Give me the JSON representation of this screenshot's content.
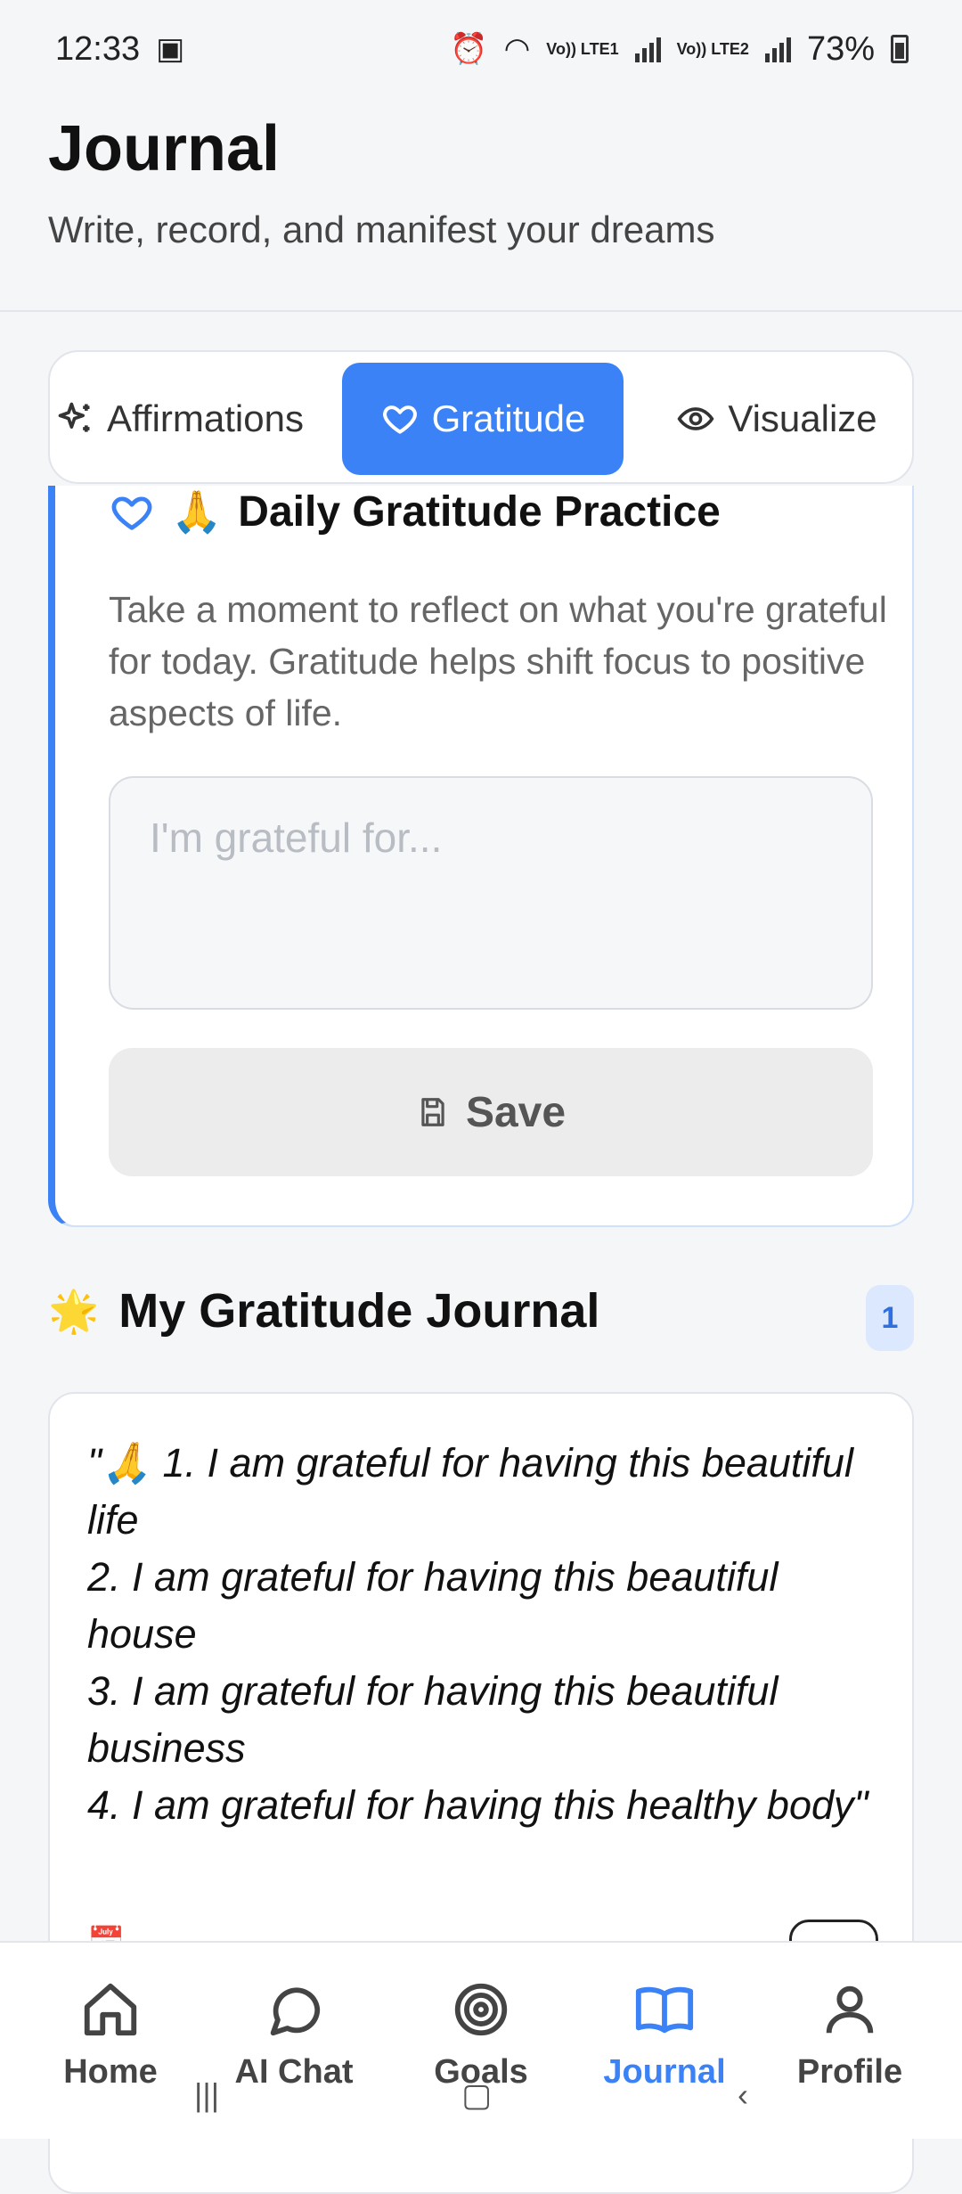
{
  "status_bar": {
    "time": "12:33",
    "battery": "73%",
    "sim1_label": "Vo)) LTE1",
    "sim2_label": "Vo)) LTE2",
    "icons": [
      "image-icon",
      "alarm-icon",
      "wifi-icon",
      "signal-icon",
      "battery-icon"
    ]
  },
  "header": {
    "title": "Journal",
    "subtitle": "Write, record, and manifest your dreams"
  },
  "tabs": [
    {
      "label": "Affirmations",
      "icon": "sparkles-icon",
      "active": false
    },
    {
      "label": "Gratitude",
      "icon": "heart-icon",
      "active": true
    },
    {
      "label": "Visualize",
      "icon": "eye-icon",
      "active": false
    }
  ],
  "practice": {
    "emoji": "🙏",
    "title": "Daily Gratitude Practice",
    "description": "Take a moment to reflect on what you're grateful for today. Gratitude helps shift focus to positive aspects of life.",
    "input_placeholder": "I'm grateful for...",
    "input_value": "",
    "save_label": "Save"
  },
  "journal": {
    "emoji": "🌟",
    "title": "My Gratitude Journal",
    "count": "1",
    "entries": [
      {
        "text": "\"🙏 1. I am grateful for having this beautiful life\n2. I am grateful for having this beautiful house\n3. I am grateful for having this beautiful business\n4. I am grateful for having this healthy body\""
      }
    ]
  },
  "bottom_nav": [
    {
      "label": "Home",
      "icon": "home-icon",
      "active": false
    },
    {
      "label": "AI Chat",
      "icon": "chat-bubble-icon",
      "active": false
    },
    {
      "label": "Goals",
      "icon": "target-icon",
      "active": false
    },
    {
      "label": "Journal",
      "icon": "book-icon",
      "active": true
    },
    {
      "label": "Profile",
      "icon": "user-icon",
      "active": false
    }
  ],
  "colors": {
    "accent": "#3b82f6",
    "background": "#f5f6f8",
    "card": "#ffffff",
    "badge_bg": "#dbe8fd"
  }
}
